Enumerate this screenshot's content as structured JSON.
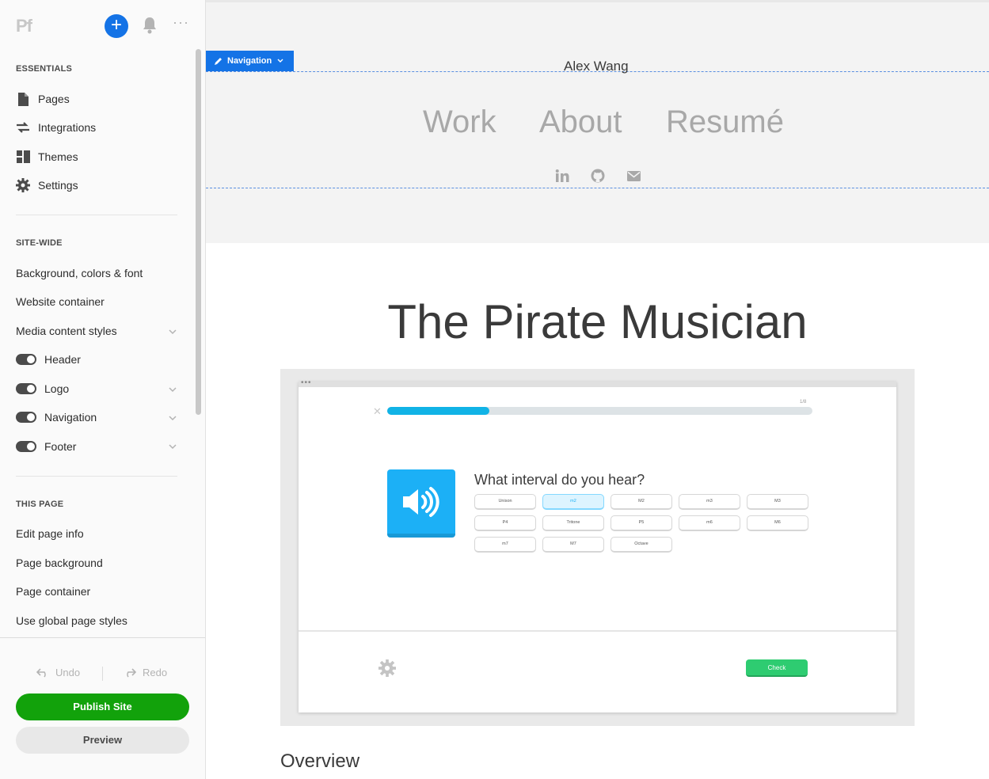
{
  "sidebar": {
    "logo": "Pf",
    "add_label": "+",
    "more_label": "···",
    "essentials_title": "ESSENTIALS",
    "essentials": [
      {
        "label": "Pages",
        "icon": "page-icon"
      },
      {
        "label": "Integrations",
        "icon": "swap-arrows-icon"
      },
      {
        "label": "Themes",
        "icon": "layout-icon"
      },
      {
        "label": "Settings",
        "icon": "gear-icon"
      }
    ],
    "sitewide_title": "SITE-WIDE",
    "sitewide": [
      {
        "label": "Background, colors & font"
      },
      {
        "label": "Website container"
      },
      {
        "label": "Media content styles"
      }
    ],
    "toggles": [
      {
        "label": "Header",
        "on": true
      },
      {
        "label": "Logo",
        "on": true
      },
      {
        "label": "Navigation",
        "on": true
      },
      {
        "label": "Footer",
        "on": true
      }
    ],
    "thispage_title": "THIS PAGE",
    "thispage": [
      {
        "label": "Edit page info"
      },
      {
        "label": "Page background"
      },
      {
        "label": "Page container"
      },
      {
        "label": "Use global page styles"
      }
    ],
    "undo_label": "Undo",
    "redo_label": "Redo",
    "publish_label": "Publish Site",
    "preview_label": "Preview"
  },
  "canvas": {
    "nav_tag_label": "Navigation",
    "site_name": "Alex Wang",
    "menu": [
      "Work",
      "About",
      "Resumé"
    ],
    "social_icons": [
      "linkedin-icon",
      "github-icon",
      "mail-icon"
    ],
    "page_title": "The Pirate Musician",
    "overview_heading": "Overview"
  },
  "embedded_app": {
    "close_label": "✕",
    "progress_fraction": 0.24,
    "count_label": "1/8",
    "question": "What interval do you hear?",
    "options": [
      "Unison",
      "m2",
      "M2",
      "m3",
      "M3",
      "P4",
      "Tritone",
      "P5",
      "m6",
      "M6",
      "m7",
      "M7",
      "Octave"
    ],
    "selected_option": "m2",
    "check_label": "Check"
  },
  "colors": {
    "accent_blue": "#1473e6",
    "publish_green": "#12a20b",
    "app_blue": "#1cb0f6",
    "check_green": "#2ecc71"
  }
}
